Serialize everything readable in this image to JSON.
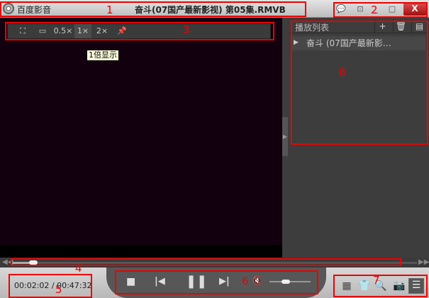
{
  "window": {
    "app_name": "百度影音",
    "file_title": "奋斗(07国产最新影视) 第05集.RMVB",
    "controls": {
      "feedback": "💬",
      "mini": "⊡",
      "minimize": "_",
      "maximize": "□",
      "close": "X"
    }
  },
  "video_toolbar": {
    "items": [
      "⛶",
      "▭",
      "0.5×",
      "1×",
      "2×",
      "📌"
    ],
    "active": "1×",
    "tooltip": "1倍显示"
  },
  "playlist": {
    "title": "播放列表",
    "add": "+",
    "delete": "🗑",
    "folder": "▤",
    "items": [
      {
        "label": "奋斗 (07国产最新影…",
        "playing": true
      }
    ]
  },
  "seek": {
    "progress_fraction": 0.043,
    "rewind": "◀◀",
    "forward": "▶▶"
  },
  "playback": {
    "current_time": "00:02:02",
    "total_time": "00:47:32",
    "time_text": "00:02:02 / 00:47:32",
    "stop": "■",
    "prev": "|◀",
    "pause": "❚❚",
    "next": "▶|",
    "mute": "🔇",
    "volume_fraction": 0.4
  },
  "right_tools": [
    "▦",
    "👕",
    "🔍",
    "📷",
    "☰"
  ],
  "annotations": [
    "1",
    "2",
    "3",
    "4",
    "5",
    "6",
    "7",
    "8"
  ]
}
